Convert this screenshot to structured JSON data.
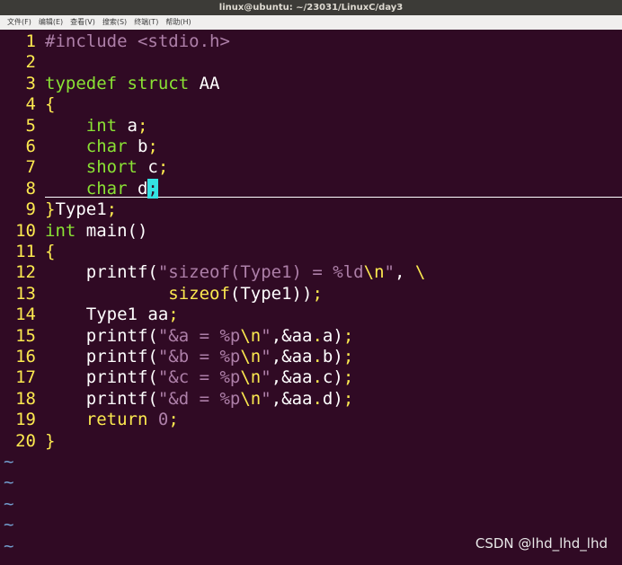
{
  "window": {
    "title": "linux@ubuntu: ~/23031/LinuxC/day3"
  },
  "menu": [
    "文件(F)",
    "编辑(E)",
    "查看(V)",
    "搜索(S)",
    "终端(T)",
    "帮助(H)"
  ],
  "lines": [
    {
      "n": "1",
      "parts": [
        [
          "pp",
          "#include "
        ],
        [
          "pp",
          "<stdio.h>"
        ]
      ]
    },
    {
      "n": "2",
      "parts": []
    },
    {
      "n": "3",
      "parts": [
        [
          "kw",
          "typedef"
        ],
        [
          "fn",
          " "
        ],
        [
          "kw",
          "struct"
        ],
        [
          "fn",
          " AA"
        ]
      ]
    },
    {
      "n": "4",
      "parts": [
        [
          "punc",
          "{"
        ]
      ]
    },
    {
      "n": "5",
      "parts": [
        [
          "fn",
          "    "
        ],
        [
          "kw",
          "int"
        ],
        [
          "fn",
          " a"
        ],
        [
          "punc",
          ";"
        ]
      ]
    },
    {
      "n": "6",
      "parts": [
        [
          "fn",
          "    "
        ],
        [
          "kw",
          "char"
        ],
        [
          "fn",
          " b"
        ],
        [
          "punc",
          ";"
        ]
      ]
    },
    {
      "n": "7",
      "parts": [
        [
          "fn",
          "    "
        ],
        [
          "kw",
          "short"
        ],
        [
          "fn",
          " c"
        ],
        [
          "punc",
          ";"
        ]
      ]
    },
    {
      "n": "8",
      "parts": [
        [
          "fn",
          "    "
        ],
        [
          "kw",
          "char"
        ],
        [
          "fn",
          " d"
        ],
        [
          "cursor",
          ";"
        ]
      ]
    },
    {
      "n": "9",
      "parts": [
        [
          "punc",
          "}"
        ],
        [
          "fn",
          "Type1"
        ],
        [
          "punc",
          ";"
        ]
      ]
    },
    {
      "n": "10",
      "parts": [
        [
          "kw",
          "int"
        ],
        [
          "fn",
          " main()"
        ]
      ]
    },
    {
      "n": "11",
      "parts": [
        [
          "punc",
          "{"
        ]
      ]
    },
    {
      "n": "12",
      "parts": [
        [
          "fn",
          "    printf("
        ],
        [
          "str",
          "\"sizeof(Type1) = %ld"
        ],
        [
          "esc",
          "\\n"
        ],
        [
          "str",
          "\""
        ],
        [
          "fn",
          ", "
        ],
        [
          "esc",
          "\\"
        ]
      ]
    },
    {
      "n": "13",
      "parts": [
        [
          "fn",
          "            "
        ],
        [
          "punc",
          "sizeof"
        ],
        [
          "fn",
          "(Type1))"
        ],
        [
          "punc",
          ";"
        ]
      ]
    },
    {
      "n": "14",
      "parts": [
        [
          "fn",
          "    Type1 aa"
        ],
        [
          "punc",
          ";"
        ]
      ]
    },
    {
      "n": "15",
      "parts": [
        [
          "fn",
          "    printf("
        ],
        [
          "str",
          "\"&a = %p"
        ],
        [
          "esc",
          "\\n"
        ],
        [
          "str",
          "\""
        ],
        [
          "fn",
          ",&aa"
        ],
        [
          "punc",
          "."
        ],
        [
          "fn",
          "a)"
        ],
        [
          "punc",
          ";"
        ]
      ]
    },
    {
      "n": "16",
      "parts": [
        [
          "fn",
          "    printf("
        ],
        [
          "str",
          "\"&b = %p"
        ],
        [
          "esc",
          "\\n"
        ],
        [
          "str",
          "\""
        ],
        [
          "fn",
          ",&aa"
        ],
        [
          "punc",
          "."
        ],
        [
          "fn",
          "b)"
        ],
        [
          "punc",
          ";"
        ]
      ]
    },
    {
      "n": "17",
      "parts": [
        [
          "fn",
          "    printf("
        ],
        [
          "str",
          "\"&c = %p"
        ],
        [
          "esc",
          "\\n"
        ],
        [
          "str",
          "\""
        ],
        [
          "fn",
          ",&aa"
        ],
        [
          "punc",
          "."
        ],
        [
          "fn",
          "c)"
        ],
        [
          "punc",
          ";"
        ]
      ]
    },
    {
      "n": "18",
      "parts": [
        [
          "fn",
          "    printf("
        ],
        [
          "str",
          "\"&d = %p"
        ],
        [
          "esc",
          "\\n"
        ],
        [
          "str",
          "\""
        ],
        [
          "fn",
          ",&aa"
        ],
        [
          "punc",
          "."
        ],
        [
          "fn",
          "d)"
        ],
        [
          "punc",
          ";"
        ]
      ]
    },
    {
      "n": "19",
      "parts": [
        [
          "fn",
          "    "
        ],
        [
          "punc",
          "return"
        ],
        [
          "fn",
          " "
        ],
        [
          "num",
          "0"
        ],
        [
          "punc",
          ";"
        ]
      ]
    },
    {
      "n": "20",
      "parts": [
        [
          "punc",
          "}"
        ]
      ]
    }
  ],
  "tildes": [
    "~",
    "~",
    "~",
    "~",
    "~"
  ],
  "watermark": "CSDN @lhd_lhd_lhd",
  "colors": {
    "background": "#300a24",
    "line_number": "#fce94f",
    "keyword": "#8ae234",
    "string": "#ad7fa8",
    "cursor": "#34e2e2",
    "tilde": "#729fcf"
  }
}
